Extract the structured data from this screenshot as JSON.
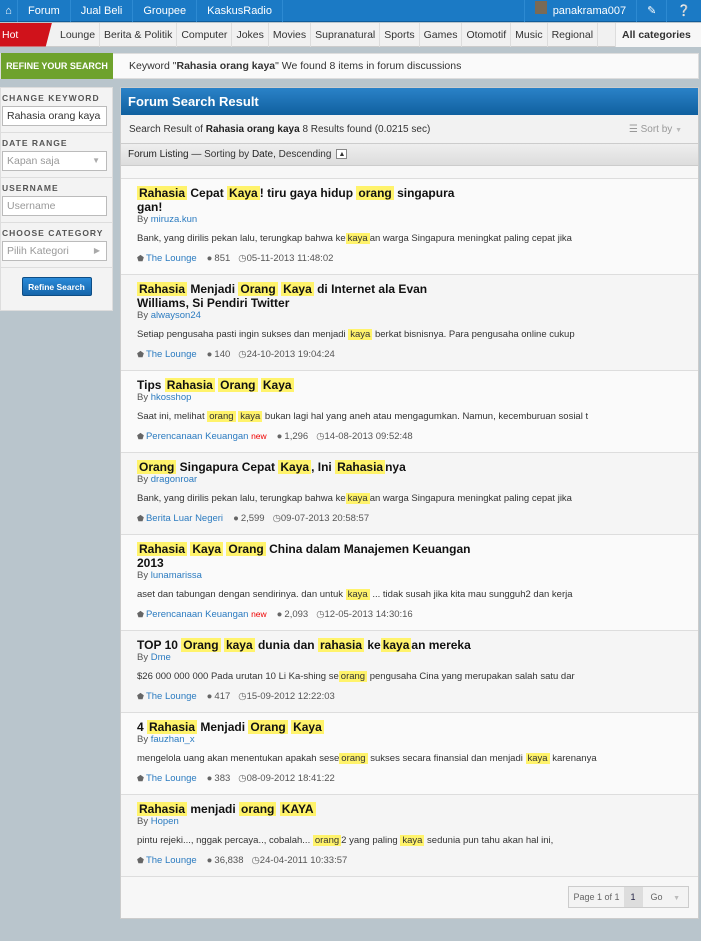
{
  "topnav": {
    "items": [
      "Forum",
      "Jual Beli",
      "Groupee",
      "KaskusRadio"
    ],
    "username": "panakrama007",
    "icons": [
      "home-icon",
      "pencil-icon",
      "help-icon"
    ]
  },
  "categories": {
    "hot": "Hot categories",
    "items": [
      "Lounge",
      "Berita & Politik",
      "Computer",
      "Jokes",
      "Movies",
      "Supranatural",
      "Sports",
      "Games",
      "Otomotif",
      "Music",
      "Regional"
    ],
    "all": "All categories"
  },
  "refine": {
    "label": "REFINE YOUR SEARCH",
    "msg_pre": "Keyword \"",
    "keyword": "Rahasia orang kaya",
    "msg_post": "\" We found 8 items in forum discussions"
  },
  "sidebar": {
    "keyword_label": "CHANGE KEYWORD",
    "keyword_value": "Rahasia orang kaya",
    "date_label": "DATE RANGE",
    "date_value": "Kapan saja",
    "username_label": "USERNAME",
    "username_placeholder": "Username",
    "category_label": "CHOOSE CATEGORY",
    "category_value": "Pilih Kategori",
    "button": "Refine Search"
  },
  "main": {
    "header": "Forum Search Result",
    "result_pre": "Search Result of ",
    "result_keyword": "Rahasia orang kaya",
    "result_count": "8 Results found (0.0215 sec)",
    "sort": "Sort by",
    "listing_label": "Forum Listing",
    "listing_mid": " — Sorting by ",
    "listing_sort": "Date",
    "listing_order": ", Descending"
  },
  "results": [
    {
      "title": [
        [
          "Rahasia",
          1
        ],
        [
          " Cepat ",
          0
        ],
        [
          "Kaya",
          1
        ],
        [
          "! tiru gaya hidup ",
          0
        ],
        [
          "orang",
          1
        ],
        [
          " singapura gan!",
          0
        ]
      ],
      "by": "miruza.kun",
      "snippet": [
        [
          "Bank, yang dirilis pekan lalu, terungkap bahwa ke",
          0
        ],
        [
          "kaya",
          1
        ],
        [
          "an warga Singapura meningkat paling cepat jika",
          0
        ]
      ],
      "category": "The Lounge",
      "new": false,
      "replies": "851",
      "date": "05-11-2013 11:48:02"
    },
    {
      "title": [
        [
          "Rahasia",
          1
        ],
        [
          " Menjadi ",
          0
        ],
        [
          "Orang",
          1
        ],
        [
          " ",
          0
        ],
        [
          "Kaya",
          1
        ],
        [
          " di Internet ala Evan Williams, Si Pendiri Twitter",
          0
        ]
      ],
      "by": "alwayson24",
      "snippet": [
        [
          "Setiap pengusaha pasti ingin sukses dan menjadi ",
          0
        ],
        [
          "kaya",
          1
        ],
        [
          " berkat bisnisnya. Para pengusaha online cukup",
          0
        ]
      ],
      "category": "The Lounge",
      "new": false,
      "replies": "140",
      "date": "24-10-2013 19:04:24"
    },
    {
      "title": [
        [
          "Tips ",
          0
        ],
        [
          "Rahasia",
          1
        ],
        [
          " ",
          0
        ],
        [
          "Orang",
          1
        ],
        [
          " ",
          0
        ],
        [
          "Kaya",
          1
        ]
      ],
      "by": "hkosshop",
      "snippet": [
        [
          "Saat ini, melihat ",
          0
        ],
        [
          "orang",
          1
        ],
        [
          " ",
          0
        ],
        [
          "kaya",
          1
        ],
        [
          " bukan lagi hal yang aneh atau mengagumkan. Namun, kecemburuan sosial t",
          0
        ]
      ],
      "category": "Perencanaan Keuangan",
      "new": true,
      "replies": "1,296",
      "date": "14-08-2013 09:52:48"
    },
    {
      "title": [
        [
          "Orang",
          1
        ],
        [
          " Singapura Cepat ",
          0
        ],
        [
          "Kaya",
          1
        ],
        [
          ", Ini ",
          0
        ],
        [
          "Rahasia",
          1
        ],
        [
          "nya",
          0
        ]
      ],
      "by": "dragonroar",
      "snippet": [
        [
          "Bank, yang dirilis pekan lalu, terungkap bahwa ke",
          0
        ],
        [
          "kaya",
          1
        ],
        [
          "an warga Singapura meningkat paling cepat jika",
          0
        ]
      ],
      "category": "Berita Luar Negeri",
      "new": false,
      "replies": "2,599",
      "date": "09-07-2013 20:58:57"
    },
    {
      "title": [
        [
          "Rahasia",
          1
        ],
        [
          " ",
          0
        ],
        [
          "Kaya",
          1
        ],
        [
          " ",
          0
        ],
        [
          "Orang",
          1
        ],
        [
          " China dalam Manajemen Keuangan 2013",
          0
        ]
      ],
      "by": "lunamarissa",
      "snippet": [
        [
          "aset dan tabungan dengan sendirinya. dan untuk ",
          0
        ],
        [
          "kaya",
          1
        ],
        [
          " ... tidak susah jika kita mau sungguh2 dan kerja",
          0
        ]
      ],
      "category": "Perencanaan Keuangan",
      "new": true,
      "replies": "2,093",
      "date": "12-05-2013 14:30:16"
    },
    {
      "title": [
        [
          "TOP 10 ",
          0
        ],
        [
          "Orang",
          1
        ],
        [
          " ",
          0
        ],
        [
          "kaya",
          1
        ],
        [
          " dunia dan ",
          0
        ],
        [
          "rahasia",
          1
        ],
        [
          " ke",
          0
        ],
        [
          "kaya",
          1
        ],
        [
          "an mereka",
          0
        ]
      ],
      "by": "Dme",
      "snippet": [
        [
          "$26 000 000 000 Pada urutan 10 Li Ka-shing se",
          0
        ],
        [
          "orang",
          1
        ],
        [
          " pengusaha Cina yang merupakan salah satu dar",
          0
        ]
      ],
      "category": "The Lounge",
      "new": false,
      "replies": "417",
      "date": "15-09-2012 12:22:03"
    },
    {
      "title": [
        [
          "4 ",
          0
        ],
        [
          "Rahasia",
          1
        ],
        [
          " Menjadi ",
          0
        ],
        [
          "Orang",
          1
        ],
        [
          " ",
          0
        ],
        [
          "Kaya",
          1
        ]
      ],
      "by": "fauzhan_x",
      "snippet": [
        [
          "mengelola uang akan menentukan apakah sese",
          0
        ],
        [
          "orang",
          1
        ],
        [
          " sukses secara finansial dan menjadi ",
          0
        ],
        [
          "kaya",
          1
        ],
        [
          " karenanya",
          0
        ]
      ],
      "category": "The Lounge",
      "new": false,
      "replies": "383",
      "date": "08-09-2012 18:41:22"
    },
    {
      "title": [
        [
          "Rahasia",
          1
        ],
        [
          " menjadi ",
          0
        ],
        [
          "orang",
          1
        ],
        [
          " ",
          0
        ],
        [
          "KAYA",
          1
        ]
      ],
      "by": "Hopen",
      "snippet": [
        [
          "pintu rejeki..., nggak percaya.., cobalah... ",
          0
        ],
        [
          "orang",
          1
        ],
        [
          "2 yang paling ",
          0
        ],
        [
          "kaya",
          1
        ],
        [
          " sedunia pun tahu akan hal ini,",
          0
        ]
      ],
      "category": "The Lounge",
      "new": false,
      "replies": "36,838",
      "date": "24-04-2011 10:33:57"
    }
  ],
  "labels": {
    "by": "By ",
    "new": "new"
  },
  "pager": {
    "page_text": "Page 1 of 1",
    "current": "1",
    "go": "Go"
  },
  "colors": {
    "nav": "#1b7ac5",
    "hot": "#d0121b",
    "refine": "#6ea22c",
    "highlight": "#fff36b",
    "link": "#2b7bc0"
  }
}
